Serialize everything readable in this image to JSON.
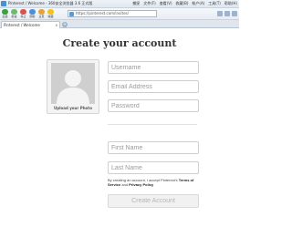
{
  "window": {
    "title": "Pinterest / Welcome - 360安全浏览器 3.6 正式版",
    "menus": [
      "捕捉",
      "文件(F)",
      "查看(V)",
      "收藏(B)",
      "帐户(A)",
      "工具(T)",
      "帮助(H)"
    ]
  },
  "toolbar": {
    "buttons": [
      {
        "label": "后退",
        "icon": "back-arrow-icon"
      },
      {
        "label": "前进",
        "icon": "forward-arrow-icon"
      },
      {
        "label": "停止",
        "icon": "stop-icon"
      },
      {
        "label": "刷新",
        "icon": "refresh-icon"
      },
      {
        "label": "主页",
        "icon": "home-icon"
      },
      {
        "label": "收藏",
        "icon": "favorites-icon"
      }
    ],
    "address": "https://pinterest.com/invites/"
  },
  "tabs": [
    {
      "label": "Pinterest / Welcome",
      "close": "x"
    }
  ],
  "page": {
    "heading": "Create your account",
    "upload_photo_label": "Upload your Photo",
    "fields": {
      "username_placeholder": "Username",
      "email_placeholder": "Email Address",
      "password_placeholder": "Password",
      "first_name_placeholder": "First Name",
      "last_name_placeholder": "Last Name"
    },
    "terms": {
      "prefix": "By creating an account, I accept Pinterest's ",
      "terms_link": "Terms of Service",
      "and": " and ",
      "privacy_link": "Privacy Policy"
    },
    "create_button": "Create Account"
  },
  "colors": {
    "button_disabled_text": "#b5b5b5",
    "placeholder_text": "#9a9a9a",
    "accent": "#4a90d9"
  }
}
